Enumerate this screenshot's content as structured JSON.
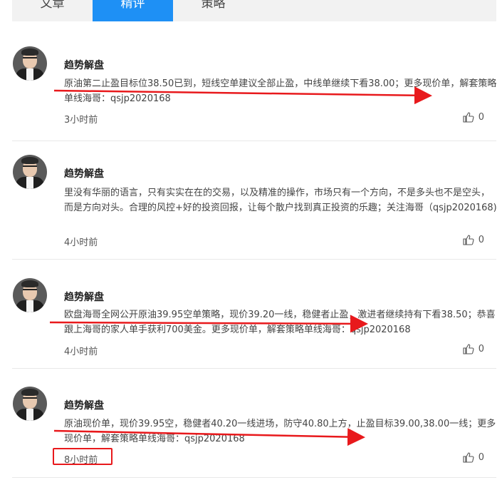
{
  "tabs": [
    {
      "label": "文章",
      "active": false
    },
    {
      "label": "精评",
      "active": true
    },
    {
      "label": "策略",
      "active": false
    }
  ],
  "posts": [
    {
      "author": "趋势解盘",
      "content": "原油第二止盈目标位38.50已到，短线空单建议全部止盈，中线单继续下看38.00；更多现价单，解套策略单线海哥：qsjp2020168",
      "time": "3小时前",
      "likes": "0"
    },
    {
      "author": "趋势解盘",
      "content": "里没有华丽的语言，只有实实在在的交易，以及精准的操作，市场只有一个方向，不是多头也不是空头，而是方向对头。合理的风控+好的投资回报，让每个散户找到真正投资的乐趣；关注海哥（qsjp2020168)",
      "time": "4小时前",
      "likes": "0"
    },
    {
      "author": "趋势解盘",
      "content": "欧盘海哥全网公开原油39.95空单策略，现价39.20一线，稳健者止盈，激进者继续持有下看38.50；恭喜跟上海哥的家人单手获利700美金。更多现价单，解套策略单线海哥：qsjp2020168",
      "time": "4小时前",
      "likes": "0"
    },
    {
      "author": "趋势解盘",
      "content": "原油现价单，现价39.95空，稳健者40.20一线进场，防守40.80上方，止盈目标39.00,38.00一线；更多现价单，解套策略单线海哥：qsjp2020168",
      "time": "8小时前",
      "likes": "0"
    }
  ],
  "colors": {
    "accent": "#1e90f5",
    "annotation": "#e8191c"
  },
  "icons": {
    "like": "thumbs-up-icon"
  }
}
